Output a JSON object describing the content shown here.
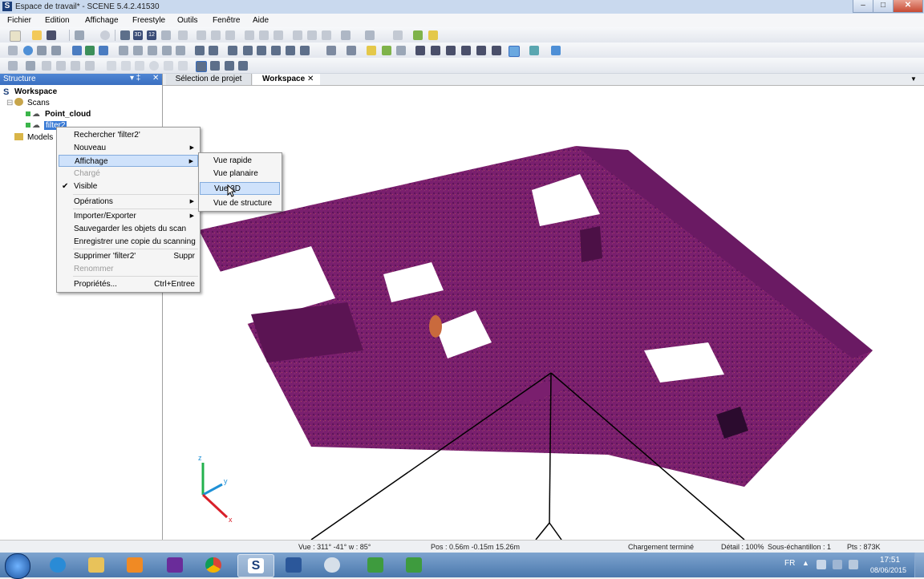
{
  "window": {
    "title": "Espace de travail* - SCENE 5.4.2.41530",
    "app_icon": "S"
  },
  "menubar": [
    "Fichier",
    "Edition",
    "Affichage",
    "Freestyle",
    "Outils",
    "Fenêtre",
    "Aide"
  ],
  "panel": {
    "title": "Structure",
    "pin": "▾ ‡",
    "close": "✕",
    "tree": {
      "workspace": "Workspace",
      "scans": "Scans",
      "point_cloud": "Point_cloud",
      "filter2": "filter2",
      "models": "Models"
    }
  },
  "tabs": [
    {
      "label": "Sélection de projet"
    },
    {
      "label": "Workspace"
    }
  ],
  "tab_close": "✕",
  "tab_menu": "▼",
  "axis": {
    "z": "z",
    "y": "y",
    "x": "x"
  },
  "context_menu": {
    "items": [
      {
        "label": "Rechercher 'filter2'",
        "shortcut": "",
        "submenu": false,
        "state": "normal"
      },
      {
        "label": "Nouveau",
        "shortcut": "",
        "submenu": true,
        "state": "normal"
      },
      {
        "label": "Affichage",
        "shortcut": "",
        "submenu": true,
        "state": "highlighted"
      },
      {
        "label": "Chargé",
        "shortcut": "",
        "submenu": false,
        "state": "disabled"
      },
      {
        "label": "Visible",
        "shortcut": "",
        "submenu": false,
        "state": "checked"
      },
      {
        "label": "Opérations",
        "shortcut": "",
        "submenu": true,
        "state": "normal"
      },
      {
        "label": "Importer/Exporter",
        "shortcut": "",
        "submenu": true,
        "state": "normal"
      },
      {
        "label": "Sauvegarder les objets du scan",
        "shortcut": "",
        "submenu": false,
        "state": "normal"
      },
      {
        "label": "Enregistrer une copie du scanning",
        "shortcut": "",
        "submenu": false,
        "state": "normal"
      },
      {
        "label": "Supprimer 'filter2'",
        "shortcut": "Suppr",
        "submenu": false,
        "state": "normal"
      },
      {
        "label": "Renommer",
        "shortcut": "",
        "submenu": false,
        "state": "disabled"
      },
      {
        "label": "Propriétés...",
        "shortcut": "Ctrl+Entree",
        "submenu": false,
        "state": "normal"
      }
    ],
    "check_mark": "✔",
    "arrow": "▶"
  },
  "submenu": {
    "items": [
      {
        "label": "Vue rapide",
        "state": "normal"
      },
      {
        "label": "Vue planaire",
        "state": "normal"
      },
      {
        "label": "Vue 3D",
        "state": "highlighted"
      },
      {
        "label": "Vue de structure",
        "state": "normal"
      }
    ]
  },
  "statusbar": {
    "view": "Vue : 311° -41° w : 85°",
    "pos": "Pos : 0.56m -0.15m 15.26m",
    "loading": "Chargement terminé",
    "detail": "Détail : 100%",
    "subsample": "Sous-échantillon : 1",
    "points": "Pts : 873K"
  },
  "taskbar": {
    "lang": "FR",
    "time": "17:51",
    "date": "08/06/2015",
    "apps": [
      "start-orb",
      "internet-explorer",
      "file-explorer",
      "media-player",
      "visual-studio",
      "chrome",
      "scene",
      "word",
      "paint",
      "camtasia-recorder",
      "camtasia-studio"
    ]
  },
  "colors": {
    "point_cloud": "#7a1f6e",
    "menu_highlight": "#cfe2fb",
    "panel_header": "#3a6fc0"
  }
}
